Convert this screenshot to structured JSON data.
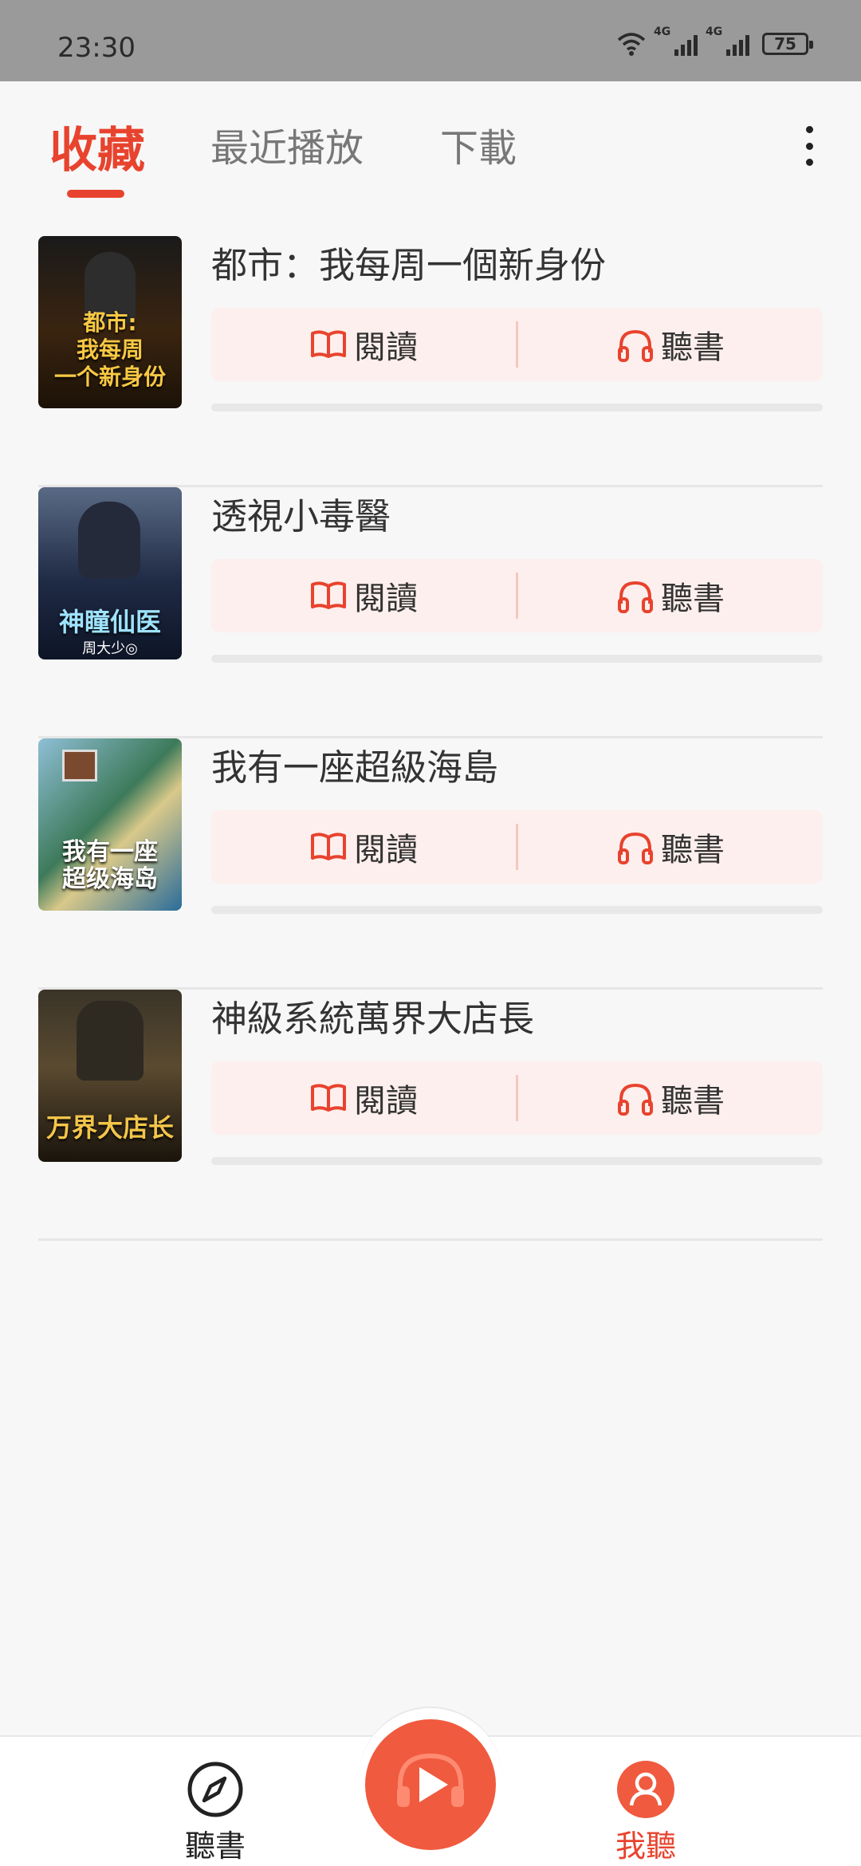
{
  "status_bar": {
    "time": "23:30",
    "battery": "75",
    "network1": "4G",
    "network2": "4G"
  },
  "tabs": {
    "favorites": "收藏",
    "recent": "最近播放",
    "download": "下載"
  },
  "books": [
    {
      "title": "都市：我每周一個新身份",
      "cover_text": "都市:\n我每周\n一个新身份",
      "read_label": "閱讀",
      "listen_label": "聽書"
    },
    {
      "title": "透視小毒醫",
      "cover_text": "神瞳仙医",
      "cover_author": "周大少◎",
      "read_label": "閱讀",
      "listen_label": "聽書"
    },
    {
      "title": "我有一座超級海島",
      "cover_text": "我有一座\n超级海岛",
      "read_label": "閱讀",
      "listen_label": "聽書"
    },
    {
      "title": "神級系統萬界大店長",
      "cover_text": "万界大店长",
      "read_label": "閱讀",
      "listen_label": "聽書"
    }
  ],
  "bottom_nav": {
    "listen": "聽書",
    "mine": "我聽"
  },
  "colors": {
    "accent": "#e8432e",
    "action_bg": "#fdefed"
  }
}
